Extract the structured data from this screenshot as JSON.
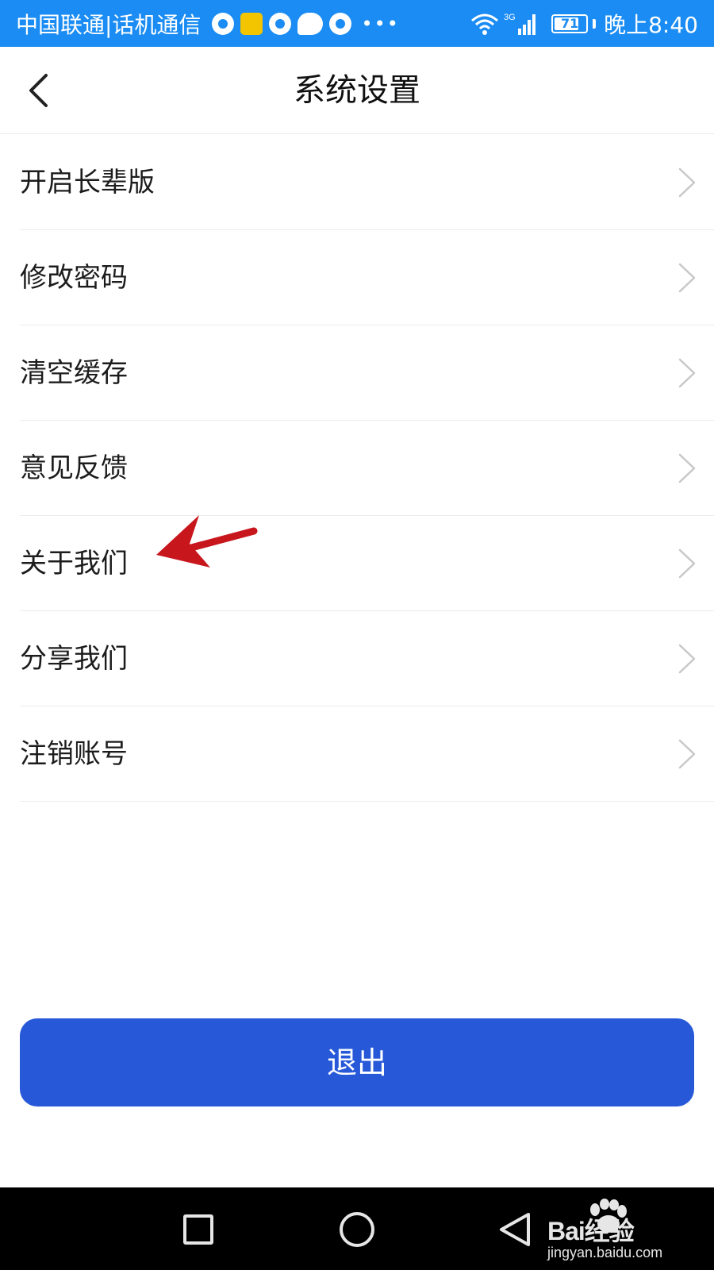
{
  "status_bar": {
    "carrier": "中国联通|话机通信",
    "battery": "71",
    "time": "晚上8:40",
    "background": "#1a8cf3",
    "icons": [
      "app-notification-icon",
      "news-app-icon",
      "bulb-app-icon",
      "chat-bubble-icon",
      "clock-app-icon",
      "more-dots-icon",
      "wifi-icon",
      "signal-3g-icon",
      "battery-icon"
    ]
  },
  "header": {
    "title": "系统设置",
    "back_icon": "chevron-left-icon"
  },
  "menu": {
    "items": [
      {
        "label": "开启长辈版"
      },
      {
        "label": "修改密码"
      },
      {
        "label": "清空缓存"
      },
      {
        "label": "意见反馈"
      },
      {
        "label": "关于我们"
      },
      {
        "label": "分享我们"
      },
      {
        "label": "注销账号"
      }
    ],
    "chevron_icon": "chevron-right-icon"
  },
  "annotation": {
    "icon": "red-arrow-icon",
    "color": "#c8161d",
    "points_to": "关于我们"
  },
  "logout": {
    "label": "退出",
    "color": "#2658d8"
  },
  "nav_bar": {
    "icons": [
      "recent-apps-icon",
      "home-icon",
      "back-triangle-icon"
    ]
  },
  "watermark": {
    "brand": "Bai经验",
    "site": "jingyan.baidu.com"
  }
}
